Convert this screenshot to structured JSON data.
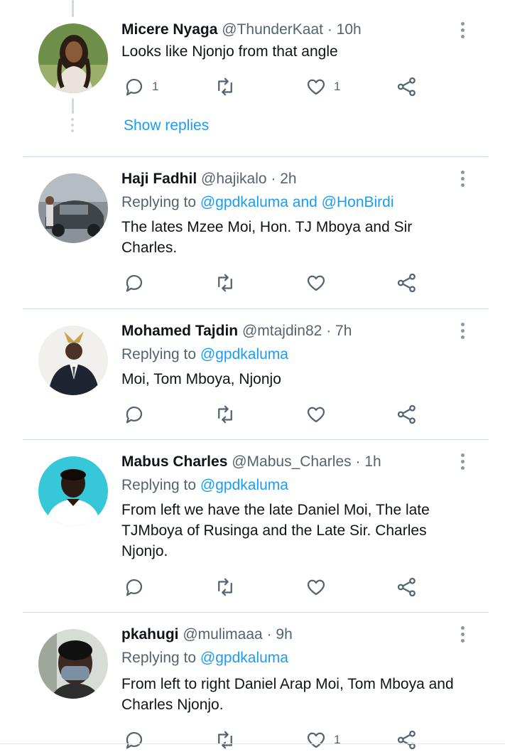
{
  "colors": {
    "link": "#1d9bf0",
    "secondary_text": "#536471",
    "icon": "#536471",
    "divider": "#cfd9de"
  },
  "tweets": [
    {
      "name": "Micere Nyaga",
      "handle": "@ThunderKaat",
      "time": "· 10h",
      "replying_prefix": "",
      "replying_mentions": "",
      "text": "Looks like Njonjo from that angle",
      "reply_count": "1",
      "retweet_count": "",
      "like_count": "1",
      "show_replies": "Show replies"
    },
    {
      "name": "Haji Fadhil",
      "handle": "@hajikalo",
      "time": "· 2h",
      "replying_prefix": "Replying to",
      "replying_mentions": "@gpdkaluma and @HonBirdi",
      "text": "The lates Mzee Moi, Hon. TJ Mboya and Sir Charles.",
      "reply_count": "",
      "retweet_count": "",
      "like_count": ""
    },
    {
      "name": "Mohamed Tajdin",
      "handle": "@mtajdin82",
      "time": "· 7h",
      "replying_prefix": "Replying to",
      "replying_mentions": "@gpdkaluma",
      "text": "Moi, Tom Mboya, Njonjo",
      "reply_count": "",
      "retweet_count": "",
      "like_count": ""
    },
    {
      "name": "Mabus Charles",
      "handle": "@Mabus_Charles",
      "time": "· 1h",
      "replying_prefix": "Replying to",
      "replying_mentions": "@gpdkaluma",
      "text": "From left we have the late Daniel Moi, The late TJMboya of Rusinga and the Late Sir. Charles Njonjo.",
      "reply_count": "",
      "retweet_count": "",
      "like_count": ""
    },
    {
      "name": "pkahugi",
      "handle": "@mulimaaa",
      "time": "· 9h",
      "replying_prefix": "Replying to",
      "replying_mentions": "@gpdkaluma",
      "text": "From left to right Daniel Arap Moi, Tom Mboya and Charles Njonjo.",
      "reply_count": "",
      "retweet_count": "",
      "like_count": "1"
    }
  ]
}
